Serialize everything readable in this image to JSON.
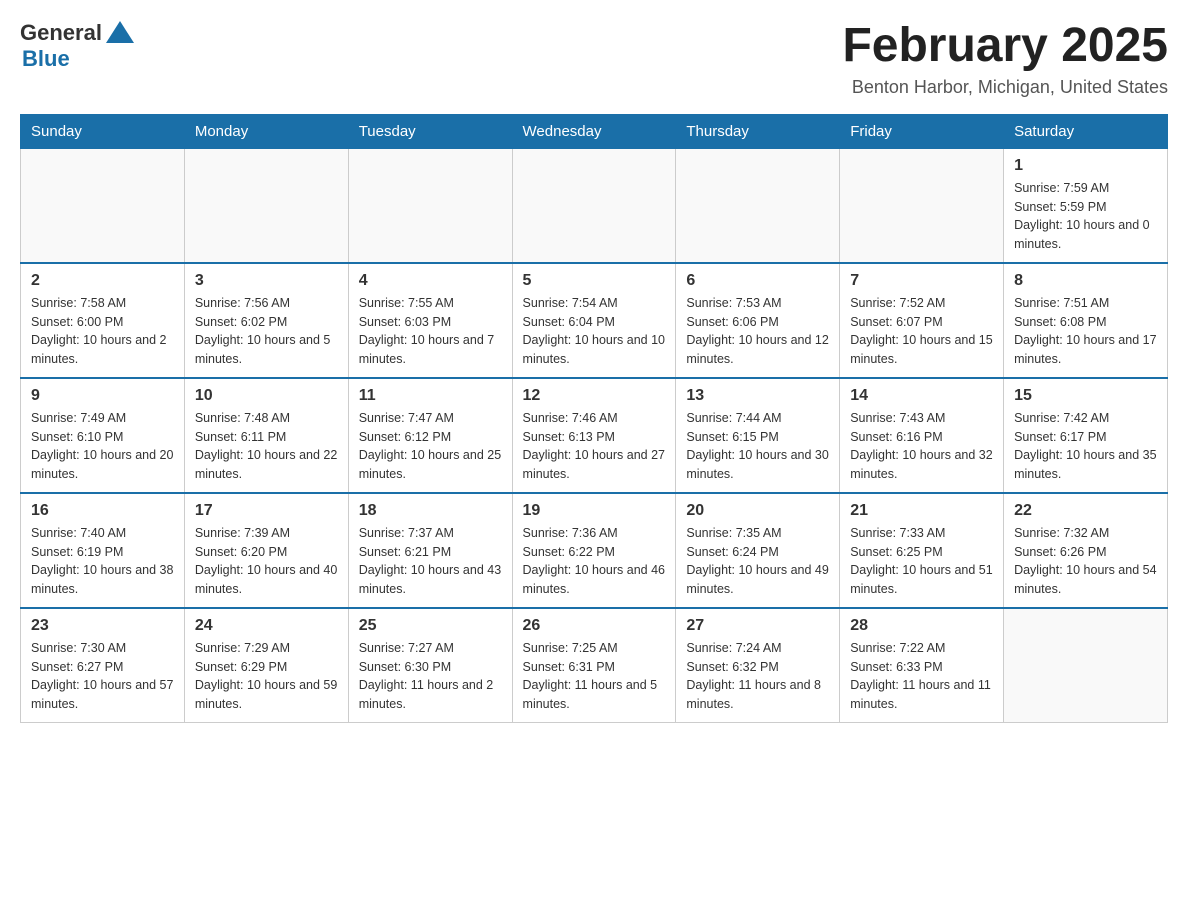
{
  "logo": {
    "general": "General",
    "blue": "Blue"
  },
  "title": "February 2025",
  "location": "Benton Harbor, Michigan, United States",
  "headers": [
    "Sunday",
    "Monday",
    "Tuesday",
    "Wednesday",
    "Thursday",
    "Friday",
    "Saturday"
  ],
  "weeks": [
    [
      {
        "day": "",
        "info": ""
      },
      {
        "day": "",
        "info": ""
      },
      {
        "day": "",
        "info": ""
      },
      {
        "day": "",
        "info": ""
      },
      {
        "day": "",
        "info": ""
      },
      {
        "day": "",
        "info": ""
      },
      {
        "day": "1",
        "info": "Sunrise: 7:59 AM\nSunset: 5:59 PM\nDaylight: 10 hours and 0 minutes."
      }
    ],
    [
      {
        "day": "2",
        "info": "Sunrise: 7:58 AM\nSunset: 6:00 PM\nDaylight: 10 hours and 2 minutes."
      },
      {
        "day": "3",
        "info": "Sunrise: 7:56 AM\nSunset: 6:02 PM\nDaylight: 10 hours and 5 minutes."
      },
      {
        "day": "4",
        "info": "Sunrise: 7:55 AM\nSunset: 6:03 PM\nDaylight: 10 hours and 7 minutes."
      },
      {
        "day": "5",
        "info": "Sunrise: 7:54 AM\nSunset: 6:04 PM\nDaylight: 10 hours and 10 minutes."
      },
      {
        "day": "6",
        "info": "Sunrise: 7:53 AM\nSunset: 6:06 PM\nDaylight: 10 hours and 12 minutes."
      },
      {
        "day": "7",
        "info": "Sunrise: 7:52 AM\nSunset: 6:07 PM\nDaylight: 10 hours and 15 minutes."
      },
      {
        "day": "8",
        "info": "Sunrise: 7:51 AM\nSunset: 6:08 PM\nDaylight: 10 hours and 17 minutes."
      }
    ],
    [
      {
        "day": "9",
        "info": "Sunrise: 7:49 AM\nSunset: 6:10 PM\nDaylight: 10 hours and 20 minutes."
      },
      {
        "day": "10",
        "info": "Sunrise: 7:48 AM\nSunset: 6:11 PM\nDaylight: 10 hours and 22 minutes."
      },
      {
        "day": "11",
        "info": "Sunrise: 7:47 AM\nSunset: 6:12 PM\nDaylight: 10 hours and 25 minutes."
      },
      {
        "day": "12",
        "info": "Sunrise: 7:46 AM\nSunset: 6:13 PM\nDaylight: 10 hours and 27 minutes."
      },
      {
        "day": "13",
        "info": "Sunrise: 7:44 AM\nSunset: 6:15 PM\nDaylight: 10 hours and 30 minutes."
      },
      {
        "day": "14",
        "info": "Sunrise: 7:43 AM\nSunset: 6:16 PM\nDaylight: 10 hours and 32 minutes."
      },
      {
        "day": "15",
        "info": "Sunrise: 7:42 AM\nSunset: 6:17 PM\nDaylight: 10 hours and 35 minutes."
      }
    ],
    [
      {
        "day": "16",
        "info": "Sunrise: 7:40 AM\nSunset: 6:19 PM\nDaylight: 10 hours and 38 minutes."
      },
      {
        "day": "17",
        "info": "Sunrise: 7:39 AM\nSunset: 6:20 PM\nDaylight: 10 hours and 40 minutes."
      },
      {
        "day": "18",
        "info": "Sunrise: 7:37 AM\nSunset: 6:21 PM\nDaylight: 10 hours and 43 minutes."
      },
      {
        "day": "19",
        "info": "Sunrise: 7:36 AM\nSunset: 6:22 PM\nDaylight: 10 hours and 46 minutes."
      },
      {
        "day": "20",
        "info": "Sunrise: 7:35 AM\nSunset: 6:24 PM\nDaylight: 10 hours and 49 minutes."
      },
      {
        "day": "21",
        "info": "Sunrise: 7:33 AM\nSunset: 6:25 PM\nDaylight: 10 hours and 51 minutes."
      },
      {
        "day": "22",
        "info": "Sunrise: 7:32 AM\nSunset: 6:26 PM\nDaylight: 10 hours and 54 minutes."
      }
    ],
    [
      {
        "day": "23",
        "info": "Sunrise: 7:30 AM\nSunset: 6:27 PM\nDaylight: 10 hours and 57 minutes."
      },
      {
        "day": "24",
        "info": "Sunrise: 7:29 AM\nSunset: 6:29 PM\nDaylight: 10 hours and 59 minutes."
      },
      {
        "day": "25",
        "info": "Sunrise: 7:27 AM\nSunset: 6:30 PM\nDaylight: 11 hours and 2 minutes."
      },
      {
        "day": "26",
        "info": "Sunrise: 7:25 AM\nSunset: 6:31 PM\nDaylight: 11 hours and 5 minutes."
      },
      {
        "day": "27",
        "info": "Sunrise: 7:24 AM\nSunset: 6:32 PM\nDaylight: 11 hours and 8 minutes."
      },
      {
        "day": "28",
        "info": "Sunrise: 7:22 AM\nSunset: 6:33 PM\nDaylight: 11 hours and 11 minutes."
      },
      {
        "day": "",
        "info": ""
      }
    ]
  ]
}
